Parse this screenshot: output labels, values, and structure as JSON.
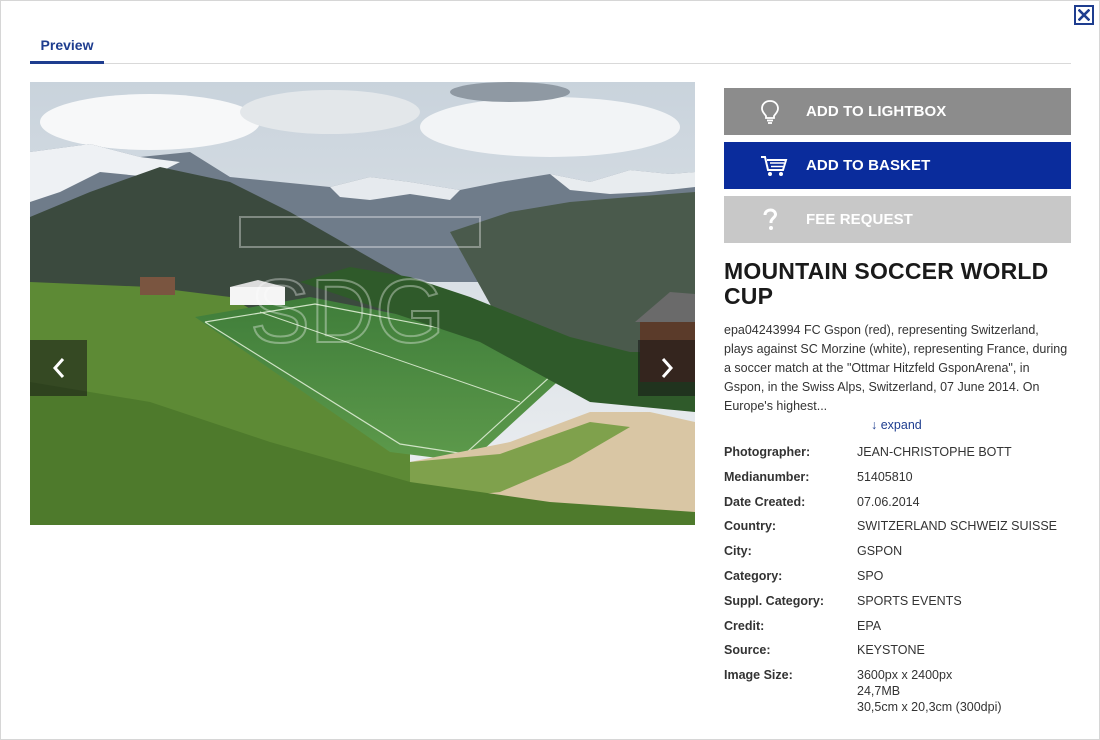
{
  "tabs": [
    {
      "label": "Preview"
    }
  ],
  "actions": {
    "lightbox": {
      "label": "ADD TO LIGHTBOX",
      "icon": "lightbulb-icon"
    },
    "basket": {
      "label": "ADD TO BASKET",
      "icon": "cart-icon"
    },
    "fee": {
      "label": "FEE REQUEST",
      "icon": "question-icon"
    }
  },
  "image": {
    "description": "Photo of a soccer match on a mountain pitch with snow-capped Alps behind",
    "watermark": "SDG"
  },
  "headline": "MOUNTAIN SOCCER WORLD CUP",
  "caption": "epa04243994 FC Gspon (red), representing Switzerland, plays against SC Morzine (white), representing France, during a soccer match at the \"Ottmar Hitzfeld GsponArena\", in Gspon, in the Swiss Alps, Switzerland, 07 June 2014. On Europe's highest...",
  "expand_label": "↓ expand",
  "metadata": {
    "photographer": {
      "label": "Photographer:",
      "value": "JEAN-CHRISTOPHE BOTT"
    },
    "medianumber": {
      "label": "Medianumber:",
      "value": "51405810"
    },
    "date_created": {
      "label": "Date Created:",
      "value": "07.06.2014"
    },
    "country": {
      "label": "Country:",
      "value": "SWITZERLAND SCHWEIZ SUISSE"
    },
    "city": {
      "label": "City:",
      "value": "GSPON"
    },
    "category": {
      "label": "Category:",
      "value": "SPO"
    },
    "suppl_category": {
      "label": "Suppl. Category:",
      "value": "SPORTS EVENTS"
    },
    "credit": {
      "label": "Credit:",
      "value": "EPA"
    },
    "source": {
      "label": "Source:",
      "value": "KEYSTONE"
    },
    "image_size": {
      "label": "Image Size:",
      "pixels": "3600px x 2400px",
      "filesize": "24,7MB",
      "print": "30,5cm x 20,3cm (300dpi)"
    }
  },
  "colors": {
    "accent": "#1e3d8f",
    "basket": "#0a2c9c",
    "lightbox": "#8c8c8c",
    "fee": "#c8c8c8"
  }
}
